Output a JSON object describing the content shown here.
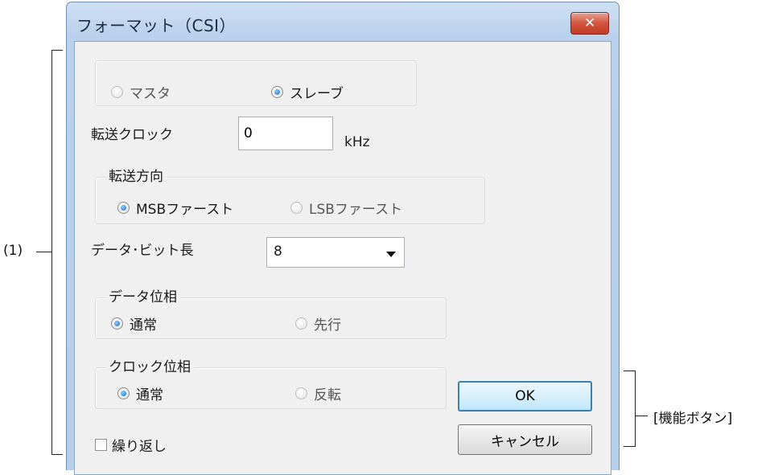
{
  "annotations": {
    "left_label": "(1)",
    "right_label": "[機能ボタン]"
  },
  "window": {
    "title": "フォーマット（CSI）",
    "close_glyph": "✕"
  },
  "mode": {
    "master_label": "マスタ",
    "slave_label": "スレーブ",
    "selected": "slave"
  },
  "transfer_clock": {
    "label": "転送クロック",
    "value": "0",
    "unit": "kHz"
  },
  "transfer_direction": {
    "legend": "転送方向",
    "msb_label": "MSBファースト",
    "lsb_label": "LSBファースト",
    "selected": "msb"
  },
  "data_bit_length": {
    "label": "データ･ビット長",
    "value": "8"
  },
  "data_phase": {
    "legend": "データ位相",
    "normal_label": "通常",
    "advance_label": "先行",
    "selected": "normal"
  },
  "clock_phase": {
    "legend": "クロック位相",
    "normal_label": "通常",
    "invert_label": "反転",
    "selected": "normal"
  },
  "repeat": {
    "label": "繰り返し",
    "checked": false
  },
  "buttons": {
    "ok_label": "OK",
    "cancel_label": "キャンセル"
  },
  "colors": {
    "selected_radio": "#1769c2",
    "default_button_border": "#3c7fb1",
    "close_button": "#c33b25"
  }
}
